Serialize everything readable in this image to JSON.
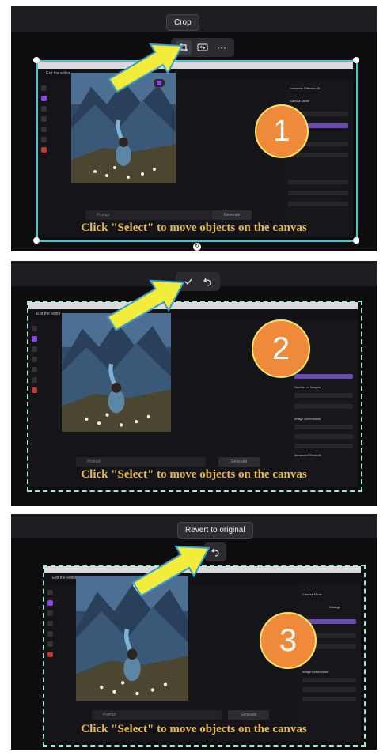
{
  "panel1": {
    "tooltip": "Crop",
    "caption": "Click \"Select\" to move objects on the canvas",
    "step": "1"
  },
  "panel2": {
    "caption": "Click \"Select\" to move objects on the canvas",
    "step": "2"
  },
  "panel3": {
    "tooltip": "Revert to original",
    "caption": "Click \"Select\" to move objects on the canvas",
    "step": "3"
  },
  "app": {
    "exit_label": "Exit the editor",
    "prompt_placeholder": "Prompt",
    "generate_label": "Generate",
    "model_name": "Leonardo Diffusion XL",
    "canvas_mode": "Canvas Mode",
    "num_images": "Number of Images",
    "image_dimensions": "Image Dimensions",
    "advanced_controls": "Advanced Controls",
    "change_label": "Change",
    "icons": {
      "crop": "crop-icon",
      "flip": "flip-icon",
      "more": "more-icon",
      "check": "check-icon",
      "undo": "undo-icon"
    }
  },
  "colors": {
    "arrow": "#f4ec3a",
    "circle_fill": "#ef8a3a",
    "circle_border": "#f4e56b",
    "caption": "#e6b84e",
    "accent": "#8b43e9",
    "frame": "#4ac6c8"
  }
}
